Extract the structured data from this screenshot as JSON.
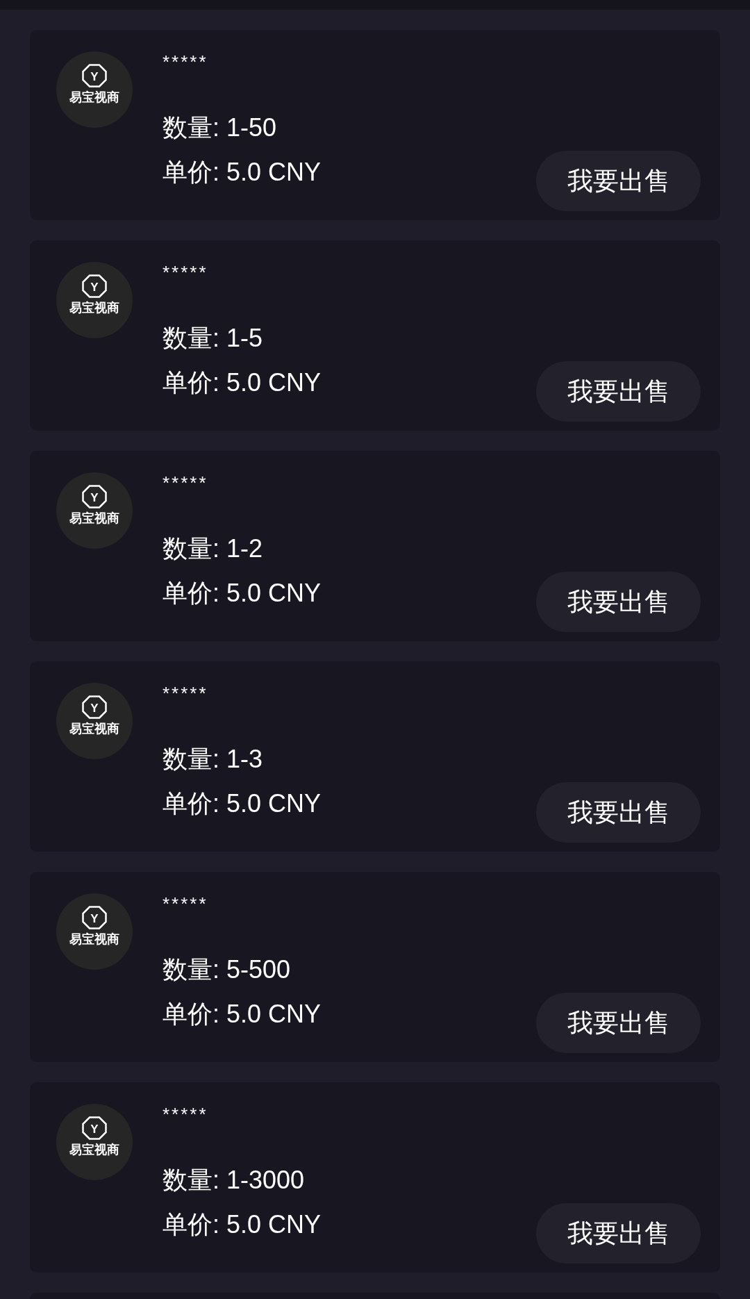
{
  "listings": [
    {
      "logo": {
        "mark": "Y",
        "name": "易宝视商"
      },
      "seller": "*****",
      "quantity": "数量: 1-50",
      "price": "单价: 5.0 CNY",
      "button": "我要出售"
    },
    {
      "logo": {
        "mark": "Y",
        "name": "易宝视商"
      },
      "seller": "*****",
      "quantity": "数量: 1-5",
      "price": "单价: 5.0 CNY",
      "button": "我要出售"
    },
    {
      "logo": {
        "mark": "Y",
        "name": "易宝视商"
      },
      "seller": "*****",
      "quantity": "数量: 1-2",
      "price": "单价: 5.0 CNY",
      "button": "我要出售"
    },
    {
      "logo": {
        "mark": "Y",
        "name": "易宝视商"
      },
      "seller": "*****",
      "quantity": "数量: 1-3",
      "price": "单价: 5.0 CNY",
      "button": "我要出售"
    },
    {
      "logo": {
        "mark": "Y",
        "name": "易宝视商"
      },
      "seller": "*****",
      "quantity": "数量: 5-500",
      "price": "单价: 5.0 CNY",
      "button": "我要出售"
    },
    {
      "logo": {
        "mark": "Y",
        "name": "易宝视商"
      },
      "seller": "*****",
      "quantity": "数量: 1-3000",
      "price": "单价: 5.0 CNY",
      "button": "我要出售"
    }
  ]
}
